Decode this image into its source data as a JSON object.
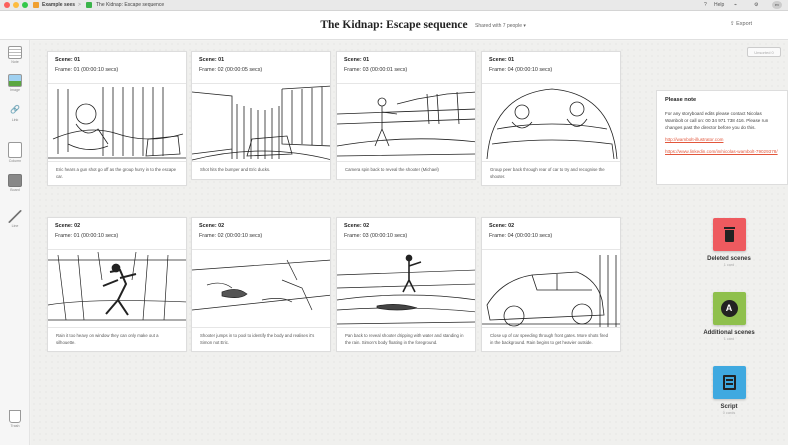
{
  "titlebar": {
    "app_label": "Example sees",
    "crumb_sep": ">",
    "doc_label": "The Kidnap: Escape sequence",
    "help": "Help",
    "user_initials": "ev"
  },
  "header": {
    "title": "The Kidnap: Escape sequence",
    "shared": "Shared with 7 people",
    "export": "Export"
  },
  "sidebar": {
    "tools": [
      {
        "label": "Note",
        "icon": "note-icon"
      },
      {
        "label": "Image",
        "icon": "image-icon"
      },
      {
        "label": "Link",
        "icon": "link-icon"
      },
      {
        "label": "Column",
        "icon": "column-icon"
      },
      {
        "label": "Board",
        "icon": "board-icon"
      },
      {
        "label": "Line",
        "icon": "line-icon"
      }
    ],
    "trash": "Trash"
  },
  "unsorted": "Unsorted 0",
  "row1": [
    {
      "scene": "Scene: 01",
      "frame": "Frame: 01 (00:00:10 secs)",
      "caption": "Eric hears a gun shot go off as the group hurry in to the escape car."
    },
    {
      "scene": "Scene: 01",
      "frame": "Frame: 02 (00:00:05 secs)",
      "caption": "Shot hits the bumper and Eric ducks."
    },
    {
      "scene": "Scene: 01",
      "frame": "Frame: 03 (00:00:01 secs)",
      "caption": "Camera spin back to reveal the shooter (Michael)"
    },
    {
      "scene": "Scene: 01",
      "frame": "Frame: 04 (00:00:10 secs)",
      "caption": "Group peer back through rear of car to try and recognise the shooter."
    }
  ],
  "row2": [
    {
      "scene": "Scene: 02",
      "frame": "Frame: 01 (00:00:10 secs)",
      "caption": "Rain it too heavy on window they can only make out a silhouette."
    },
    {
      "scene": "Scene: 02",
      "frame": "Frame: 02 (00:00:10 secs)",
      "caption": "Shooter jumps in to pool to identify the body and realises it's Simon not Eric."
    },
    {
      "scene": "Scene: 02",
      "frame": "Frame: 03 (00:00:10 secs)",
      "caption": "Pan back to reveal shooter dripping with water and standing in the rain. Simon's body floating in the foreground."
    },
    {
      "scene": "Scene: 02",
      "frame": "Frame: 04 (00:00:10 secs)",
      "caption": "Close up of car speeding through front gates. More shots fired in the background. Rain begins to get heavier outside."
    }
  ],
  "note": {
    "title": "Please note",
    "body": "For any storyboard edits please contact Nicolas Wambolt or call on: 00 34 971 738 416. Please run changes past the director before you do this.",
    "link1": "http://wambolt-illustrator.com",
    "link2": "https://www.linkedin.com/in/nicolas-wambolt-79029378/"
  },
  "bins": [
    {
      "title": "Deleted scenes",
      "count": "1 card",
      "color": "#ee5a5f",
      "icon": "trash-icon"
    },
    {
      "title": "Additional scenes",
      "count": "1 card",
      "color": "#8fc04d",
      "icon": "a-icon"
    },
    {
      "title": "Script",
      "count": "0 cards",
      "color": "#3fa9e0",
      "icon": "script-icon"
    }
  ]
}
